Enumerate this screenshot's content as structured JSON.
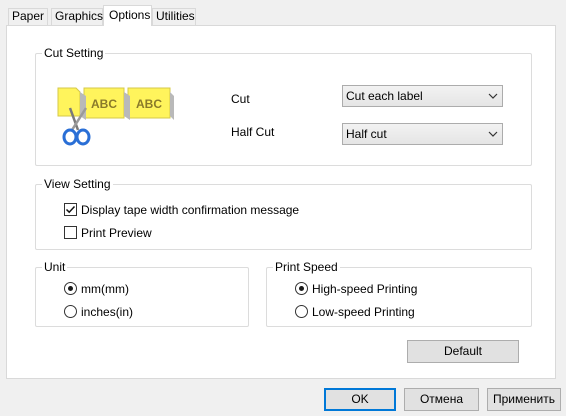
{
  "tabs": [
    {
      "label": "Paper"
    },
    {
      "label": "Graphics"
    },
    {
      "label": "Options",
      "active": true
    },
    {
      "label": "Utilities"
    }
  ],
  "cut_setting": {
    "legend": "Cut Setting",
    "illustration": {
      "label1": "ABC",
      "label2": "ABC",
      "icon": "scissors-icon"
    },
    "cut_label": "Cut",
    "cut_value": "Cut each label",
    "half_cut_label": "Half Cut",
    "half_cut_value": "Half cut"
  },
  "view_setting": {
    "legend": "View Setting",
    "display_tape_width": {
      "label": "Display tape width confirmation message",
      "checked": true
    },
    "print_preview": {
      "label": "Print Preview",
      "checked": false
    }
  },
  "unit": {
    "legend": "Unit",
    "options": [
      {
        "label": "mm(mm)",
        "selected": true
      },
      {
        "label": "inches(in)",
        "selected": false
      }
    ]
  },
  "print_speed": {
    "legend": "Print Speed",
    "options": [
      {
        "label": "High-speed Printing",
        "selected": true
      },
      {
        "label": "Low-speed Printing",
        "selected": false
      }
    ]
  },
  "default_button": "Default",
  "footer": {
    "ok": "OK",
    "cancel": "Отмена",
    "apply": "Применить"
  },
  "colors": {
    "label_yellow": "#fff45c",
    "label_text": "#8a7a2a",
    "scissors_blue": "#2a6fd6",
    "focus_blue": "#0078d7"
  }
}
